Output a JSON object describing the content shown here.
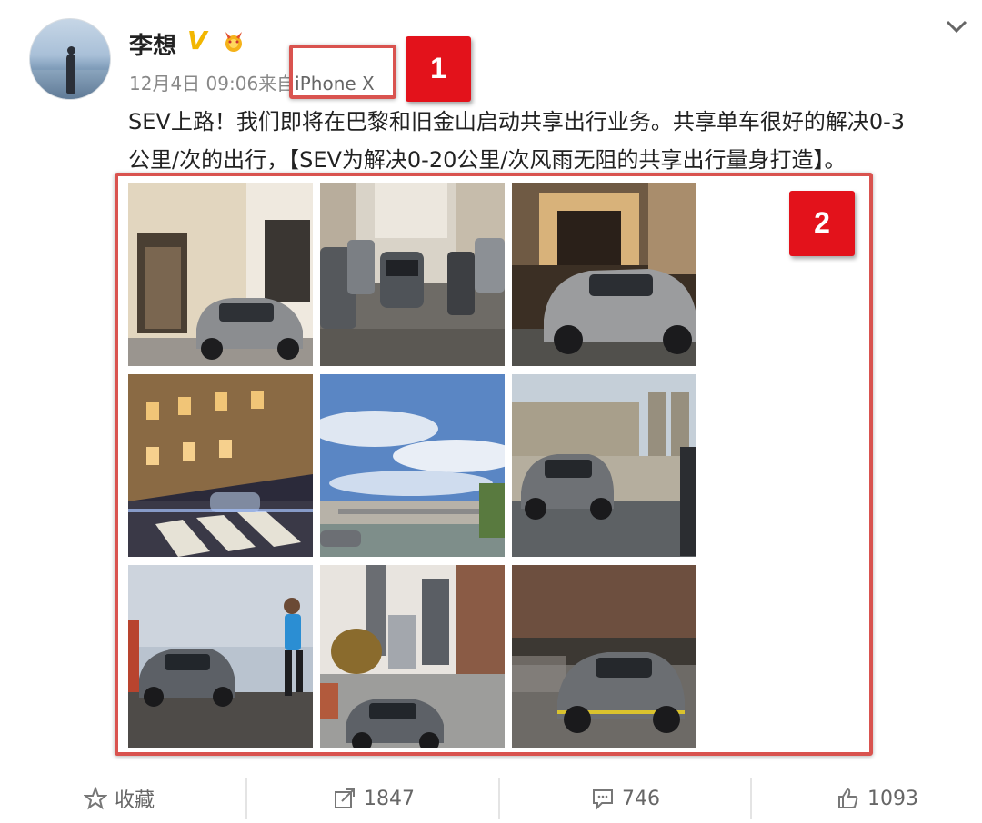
{
  "post": {
    "username": "李想",
    "meta_time": "12月4日 09:06",
    "meta_from": "来自",
    "meta_source": "iPhone X",
    "text_line1": "SEV上路！我们即将在巴黎和旧金山启动共享出行业务。共享单车很好的解决0-3",
    "text_line2": "公里/次的出行，【SEV为解决0-20公里/次风雨无阻的共享出行量身打造】。"
  },
  "annotations": {
    "label1": "1",
    "label2": "2"
  },
  "actions": {
    "favorite": "收藏",
    "repost_count": "1847",
    "comment_count": "746",
    "like_count": "1093"
  },
  "colors": {
    "annotation_red": "#e3121b",
    "verified_gold": "#f2b600"
  },
  "icons": [
    "chevron-down-icon",
    "verified-icon",
    "medal-icon",
    "star-icon",
    "repost-icon",
    "comment-icon",
    "like-icon"
  ]
}
